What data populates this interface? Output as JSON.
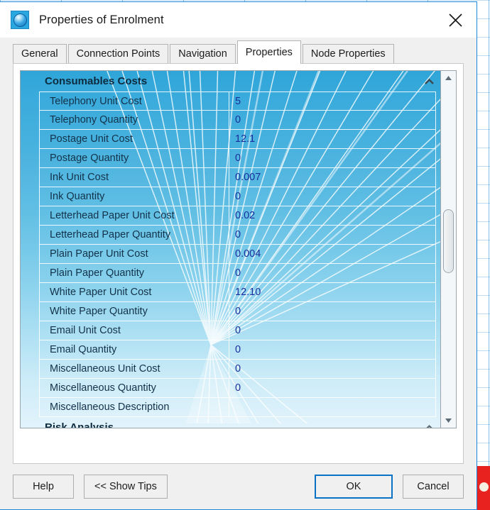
{
  "window": {
    "title": "Properties of Enrolment",
    "icon": "sphere-icon",
    "close_label": "✕",
    "accent_color": "#1c88d8"
  },
  "tabs": [
    {
      "label": "General",
      "active": false
    },
    {
      "label": "Connection Points",
      "active": false
    },
    {
      "label": "Navigation",
      "active": false
    },
    {
      "label": "Properties",
      "active": true
    },
    {
      "label": "Node Properties",
      "active": false
    }
  ],
  "property_grid": {
    "sections": [
      {
        "title": "Consumables Costs",
        "state": "expanded",
        "chevron": "chevron-up-icon"
      },
      {
        "title": "Risk Analysis",
        "state": "collapsed",
        "chevron": "chevron-up-icon"
      }
    ],
    "rows": [
      {
        "name": "Telephony Unit Cost",
        "value": "5"
      },
      {
        "name": "Telephony Quantity",
        "value": "0"
      },
      {
        "name": "Postage Unit Cost",
        "value": "12.1"
      },
      {
        "name": "Postage Quantity",
        "value": "0"
      },
      {
        "name": "Ink Unit Cost",
        "value": "0.007"
      },
      {
        "name": "Ink Quantity",
        "value": "0"
      },
      {
        "name": "Letterhead Paper Unit Cost",
        "value": "0.02"
      },
      {
        "name": "Letterhead Paper Quantity",
        "value": "0"
      },
      {
        "name": "Plain Paper Unit Cost",
        "value": "0.004"
      },
      {
        "name": "Plain Paper Quantity",
        "value": "0"
      },
      {
        "name": "White Paper Unit Cost",
        "value": "12.10"
      },
      {
        "name": "White Paper Quantity",
        "value": "0"
      },
      {
        "name": "Email Unit Cost",
        "value": "0"
      },
      {
        "name": "Email Quantity",
        "value": "0"
      },
      {
        "name": "Miscellaneous Unit Cost",
        "value": "0"
      },
      {
        "name": "Miscellaneous Quantity",
        "value": "0"
      },
      {
        "name": "Miscellaneous Description",
        "value": ""
      }
    ],
    "scrollbar": {
      "up_arrow": "triangle-up-icon",
      "down_arrow": "triangle-down-icon",
      "orientation": "vertical"
    }
  },
  "buttons": {
    "help": "Help",
    "show_tips": "<< Show Tips",
    "ok": "OK",
    "cancel": "Cancel"
  }
}
